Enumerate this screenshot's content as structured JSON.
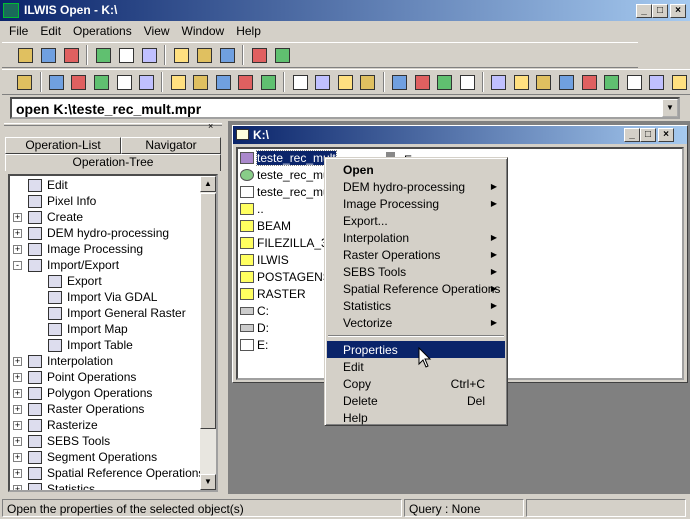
{
  "window": {
    "title": "ILWIS Open - K:\\",
    "minimize": "_",
    "maximize": "□",
    "close": "×"
  },
  "menu": [
    "File",
    "Edit",
    "Operations",
    "View",
    "Window",
    "Help"
  ],
  "toolbar1": [
    "open-folder",
    "show",
    "properties",
    "copy",
    "paste",
    "delete",
    "create-new",
    "pyramid-link",
    "details-view",
    "list-view",
    "up-folder"
  ],
  "toolbar2": [
    "ilwis-logo",
    "raster-map",
    "polygon-map",
    "segment-map",
    "point-map",
    "table",
    "map-list",
    "object-collection",
    "map-view",
    "layout",
    "annotation-text",
    "graph",
    "domain",
    "representation",
    "georeference",
    "coordinate-system",
    "histogram-raster",
    "histogram-polygon",
    "histogram-segment",
    "histogram-point",
    "sample-set",
    "stereo-pair",
    "tree-script",
    "table-view",
    "matrix",
    "filter",
    "function",
    "script"
  ],
  "command": {
    "value": "open K:\\teste_rec_mult.mpr"
  },
  "left_panel": {
    "tabs": [
      "Operation-List",
      "Navigator",
      "Operation-Tree"
    ],
    "tree": [
      {
        "label": "Edit",
        "level": 1,
        "expander": ""
      },
      {
        "label": "Pixel Info",
        "level": 1,
        "expander": ""
      },
      {
        "label": "Create",
        "level": 0,
        "expander": "+"
      },
      {
        "label": "DEM hydro-processing",
        "level": 0,
        "expander": "+"
      },
      {
        "label": "Image Processing",
        "level": 0,
        "expander": "+"
      },
      {
        "label": "Import/Export",
        "level": 0,
        "expander": "-"
      },
      {
        "label": "Export",
        "level": 2,
        "expander": ""
      },
      {
        "label": "Import Via GDAL",
        "level": 2,
        "expander": ""
      },
      {
        "label": "Import General Raster",
        "level": 2,
        "expander": ""
      },
      {
        "label": "Import Map",
        "level": 2,
        "expander": ""
      },
      {
        "label": "Import Table",
        "level": 2,
        "expander": ""
      },
      {
        "label": "Interpolation",
        "level": 0,
        "expander": "+"
      },
      {
        "label": "Point Operations",
        "level": 0,
        "expander": "+"
      },
      {
        "label": "Polygon Operations",
        "level": 0,
        "expander": "+"
      },
      {
        "label": "Raster Operations",
        "level": 0,
        "expander": "+"
      },
      {
        "label": "Rasterize",
        "level": 0,
        "expander": "+"
      },
      {
        "label": "SEBS Tools",
        "level": 0,
        "expander": "+"
      },
      {
        "label": "Segment Operations",
        "level": 0,
        "expander": "+"
      },
      {
        "label": "Spatial Reference Operations",
        "level": 0,
        "expander": "+"
      },
      {
        "label": "Statistics",
        "level": 0,
        "expander": "+"
      }
    ]
  },
  "catalog": {
    "title": "K:\\",
    "files": [
      {
        "name": "teste_rec_mult",
        "icon": "map-list",
        "selected": true
      },
      {
        "name": "teste_rec_mult",
        "icon": "georeference"
      },
      {
        "name": "teste_rec_mult",
        "icon": "point-map"
      },
      {
        "name": "..",
        "icon": "folder"
      },
      {
        "name": "BEAM",
        "icon": "folder"
      },
      {
        "name": "FILEZILLA_3.3",
        "icon": "folder"
      },
      {
        "name": "ILWIS",
        "icon": "folder"
      },
      {
        "name": "POSTAGENS_",
        "icon": "folder"
      },
      {
        "name": "RASTER",
        "icon": "folder"
      },
      {
        "name": "C:",
        "icon": "drive"
      },
      {
        "name": "D:",
        "icon": "drive"
      },
      {
        "name": "E:",
        "icon": "network-drive"
      }
    ],
    "second_col": "E:"
  },
  "context_menu": [
    {
      "label": "Open",
      "bold": true
    },
    {
      "label": "DEM hydro-processing",
      "submenu": true
    },
    {
      "label": "Image Processing",
      "submenu": true
    },
    {
      "label": "Export..."
    },
    {
      "label": "Interpolation",
      "submenu": true
    },
    {
      "label": "Raster Operations",
      "submenu": true
    },
    {
      "label": "SEBS Tools",
      "submenu": true
    },
    {
      "label": "Spatial Reference Operations",
      "submenu": true
    },
    {
      "label": "Statistics",
      "submenu": true
    },
    {
      "label": "Vectorize",
      "submenu": true
    },
    {
      "separator": true
    },
    {
      "label": "Properties",
      "highlighted": true
    },
    {
      "label": "Edit"
    },
    {
      "label": "Copy",
      "shortcut": "Ctrl+C"
    },
    {
      "label": "Delete",
      "shortcut": "Del"
    },
    {
      "label": "Help"
    }
  ],
  "status": {
    "message": "Open the properties of the selected object(s)",
    "query": "Query : None"
  },
  "colors": {
    "title_active": "#0a246a",
    "title_gradient_end": "#a6caf0",
    "face": "#d4d0c8",
    "mdi_bg": "#808080"
  }
}
